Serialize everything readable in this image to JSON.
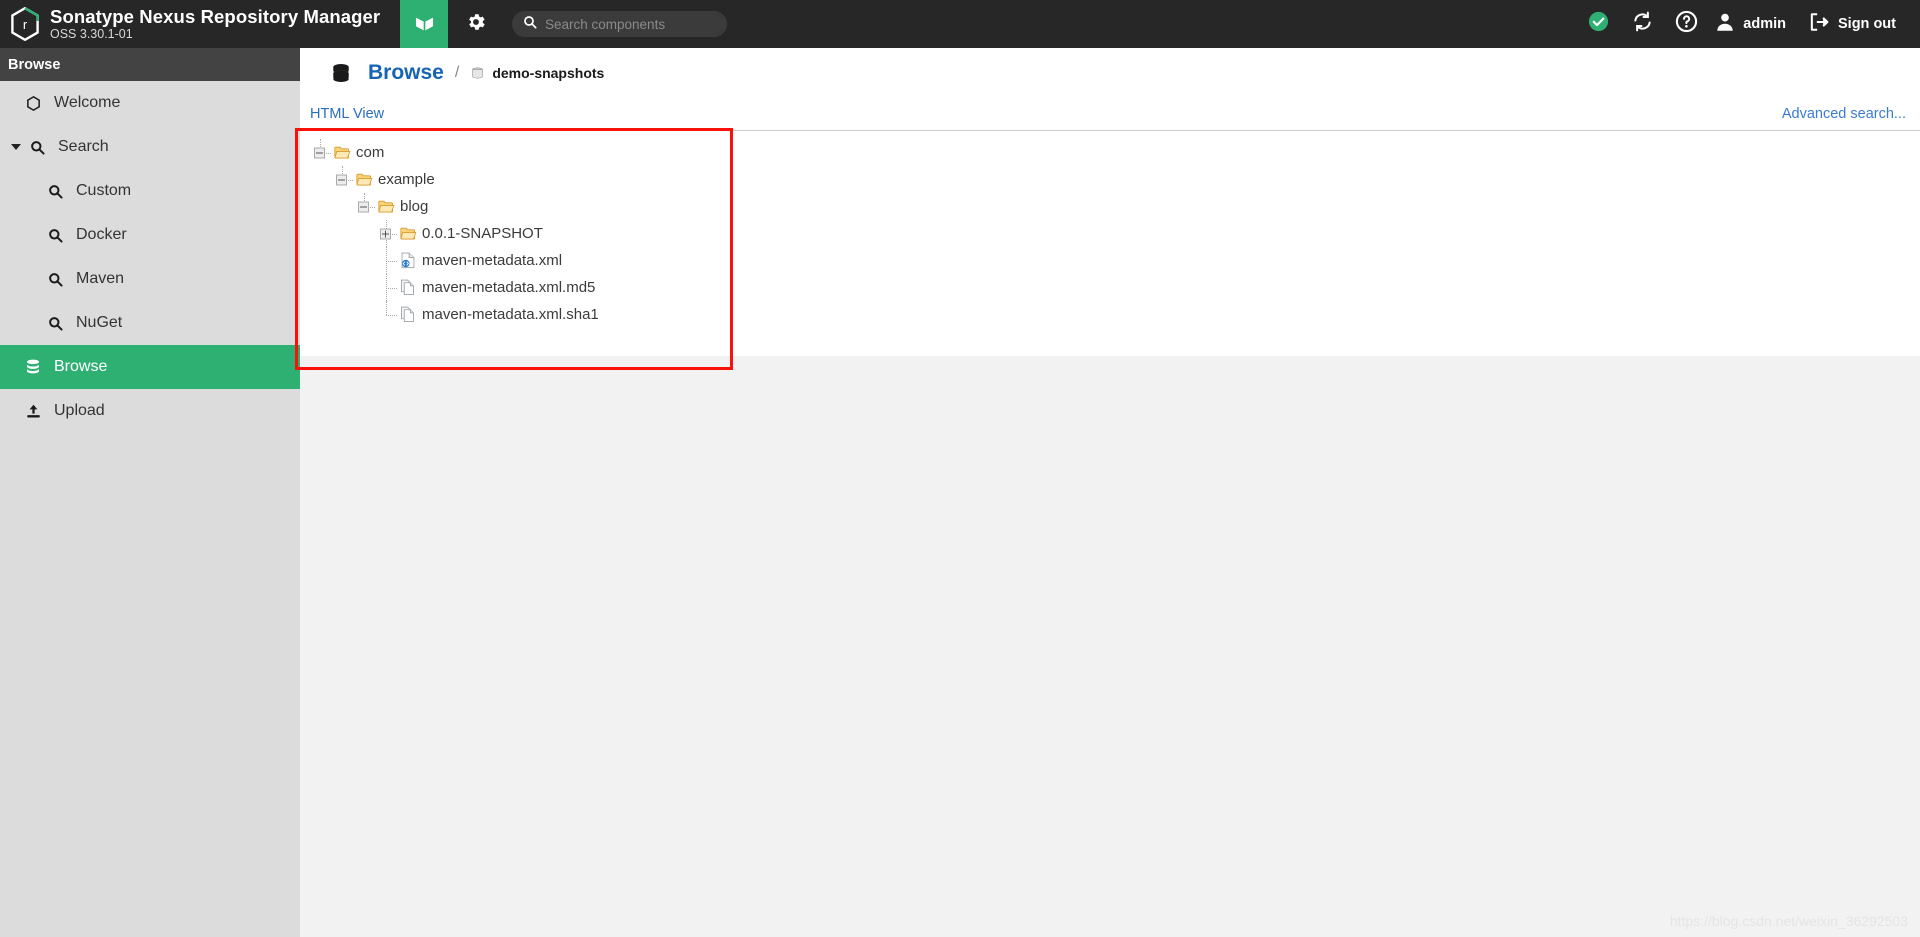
{
  "header": {
    "brand_title": "Sonatype Nexus Repository Manager",
    "brand_subtitle": "OSS 3.30.1-01",
    "tab_icon": "cube-icon",
    "gear_icon": "gear-icon",
    "search": {
      "placeholder": "Search components",
      "value": "",
      "icon": "search-icon"
    },
    "status_icon": "check-circle-icon",
    "refresh_icon": "refresh-icon",
    "help_icon": "help-circle-icon",
    "user_icon": "user-icon",
    "user_label": "admin",
    "signout_icon": "sign-out-icon",
    "signout_label": "Sign out",
    "accent_color": "#2eb073",
    "bar_color": "#272727"
  },
  "sidebar": {
    "section_title": "Browse",
    "items": [
      {
        "label": "Welcome",
        "icon": "hexagon-icon",
        "level": "top",
        "active": false,
        "caret": false
      },
      {
        "label": "Search",
        "icon": "search-icon",
        "level": "group",
        "active": false,
        "caret": true
      },
      {
        "label": "Custom",
        "icon": "search-icon",
        "level": "sub",
        "active": false,
        "caret": false
      },
      {
        "label": "Docker",
        "icon": "search-icon",
        "level": "sub",
        "active": false,
        "caret": false
      },
      {
        "label": "Maven",
        "icon": "search-icon",
        "level": "sub",
        "active": false,
        "caret": false
      },
      {
        "label": "NuGet",
        "icon": "search-icon",
        "level": "sub",
        "active": false,
        "caret": false
      },
      {
        "label": "Browse",
        "icon": "database-icon",
        "level": "top",
        "active": true,
        "caret": false
      },
      {
        "label": "Upload",
        "icon": "upload-icon",
        "level": "top",
        "active": false,
        "caret": false
      }
    ]
  },
  "main": {
    "breadcrumb": {
      "icon": "database-icon",
      "root": "Browse",
      "separator": "/",
      "leaf_icon": "repository-icon",
      "leaf": "demo-snapshots"
    },
    "toolbar": {
      "html_view_label": "HTML View",
      "advanced_search_label": "Advanced search..."
    },
    "tree": [
      {
        "label": "com",
        "depth": 0,
        "toggle": "minus",
        "icon": "folder-open-icon"
      },
      {
        "label": "example",
        "depth": 1,
        "toggle": "minus",
        "icon": "folder-open-icon"
      },
      {
        "label": "blog",
        "depth": 2,
        "toggle": "minus",
        "icon": "folder-open-icon"
      },
      {
        "label": "0.0.1-SNAPSHOT",
        "depth": 3,
        "toggle": "plus",
        "icon": "folder-open-icon"
      },
      {
        "label": "maven-metadata.xml",
        "depth": 3,
        "toggle": "none",
        "icon": "xml-file-icon"
      },
      {
        "label": "maven-metadata.xml.md5",
        "depth": 3,
        "toggle": "none",
        "icon": "file-icon"
      },
      {
        "label": "maven-metadata.xml.sha1",
        "depth": 3,
        "toggle": "none",
        "icon": "file-icon"
      }
    ],
    "annotation": {
      "color": "#fb1109"
    },
    "watermark": "https://blog.csdn.net/weixin_36292503"
  }
}
